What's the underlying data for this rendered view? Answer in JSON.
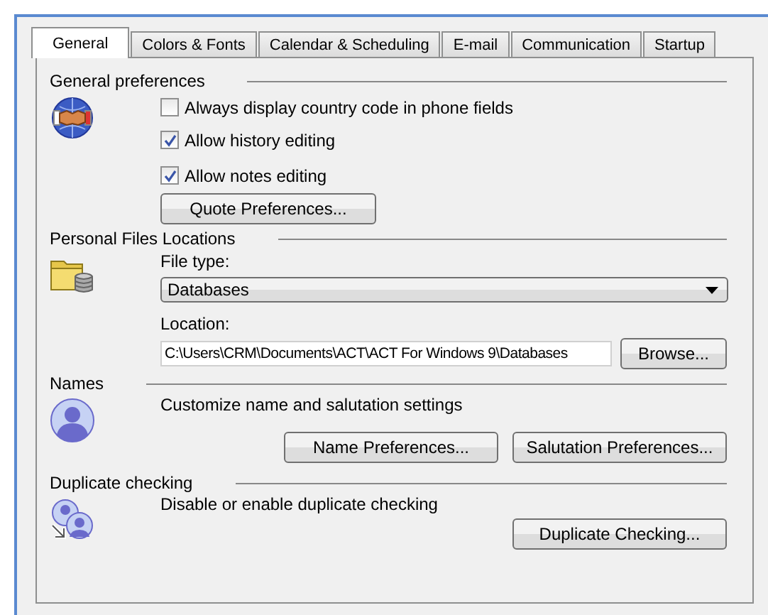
{
  "tabs": [
    {
      "label": "General",
      "selected": true
    },
    {
      "label": "Colors & Fonts",
      "selected": false
    },
    {
      "label": "Calendar & Scheduling",
      "selected": false
    },
    {
      "label": "E-mail",
      "selected": false
    },
    {
      "label": "Communication",
      "selected": false
    },
    {
      "label": "Startup",
      "selected": false
    }
  ],
  "general_preferences": {
    "title": "General preferences",
    "checkboxes": [
      {
        "label": "Always display country code in phone fields",
        "checked": false
      },
      {
        "label": "Allow history editing",
        "checked": true
      },
      {
        "label": "Allow notes editing",
        "checked": true
      }
    ],
    "button": "Quote Preferences..."
  },
  "personal_files_locations": {
    "title": "Personal Files Locations",
    "file_type_label": "File type:",
    "file_type": "Databases",
    "location_label": "Location:",
    "location": "C:\\Users\\CRM\\Documents\\ACT\\ACT For Windows 9\\Databases",
    "browse_button": "Browse..."
  },
  "names": {
    "title": "Names",
    "description": "Customize name and salutation settings",
    "buttons": [
      "Name Preferences...",
      "Salutation Preferences..."
    ]
  },
  "duplicate_checking": {
    "title": "Duplicate checking",
    "description": "Disable or enable duplicate checking",
    "button": "Duplicate Checking..."
  }
}
